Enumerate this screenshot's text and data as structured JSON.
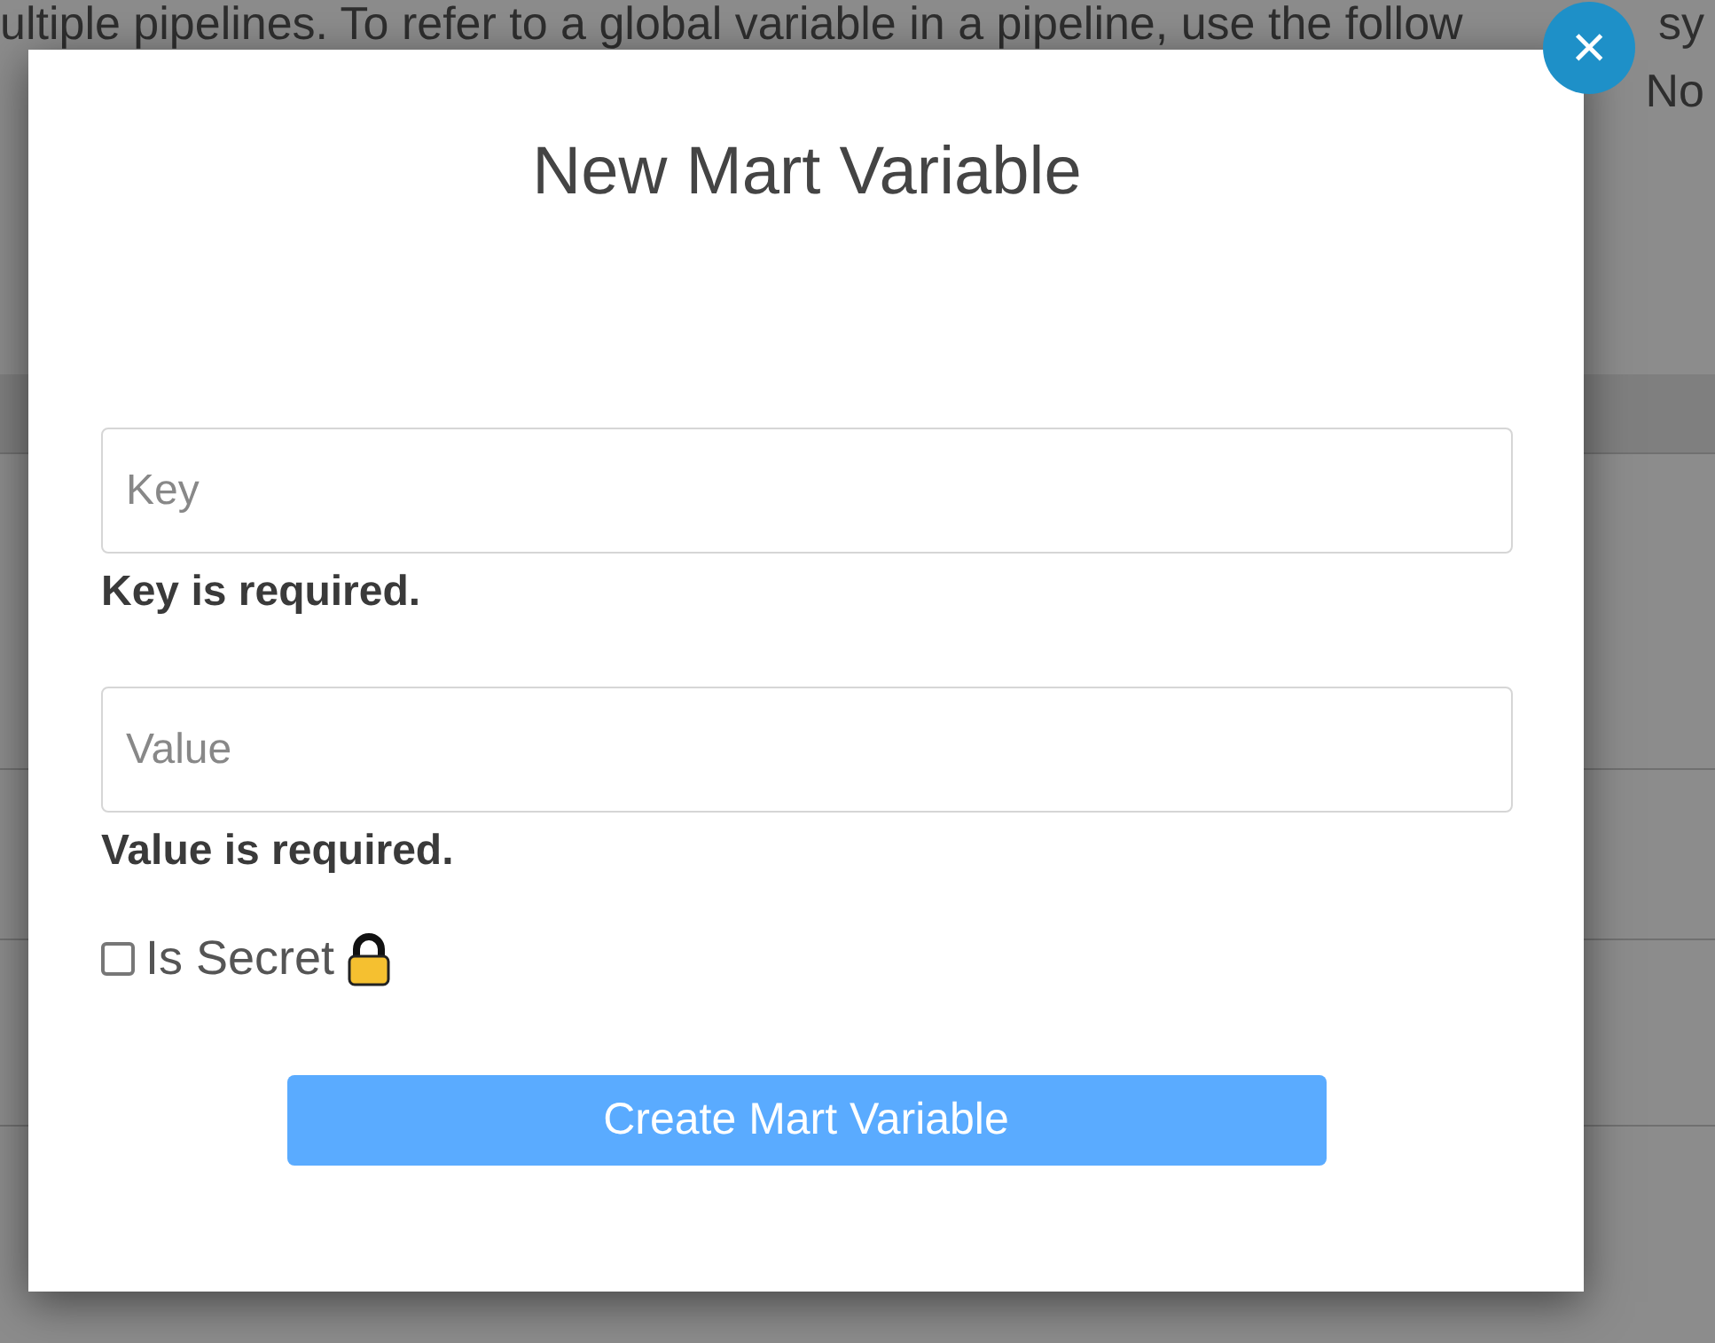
{
  "background": {
    "lines": [
      {
        "parts": [
          "ultiple pipelines. To refer to a global variable in a pipeline, use the follow",
          "sy"
        ]
      },
      {
        "parts": [
          "No"
        ]
      }
    ]
  },
  "modal": {
    "title": "New Mart Variable",
    "close_label": "×",
    "fields": [
      {
        "placeholder": "Key",
        "error": "Key is required."
      },
      {
        "placeholder": "Value",
        "error": "Value is required."
      }
    ],
    "secret": {
      "label": "Is Secret",
      "checked": false
    },
    "submit": "Create Mart Variable"
  }
}
